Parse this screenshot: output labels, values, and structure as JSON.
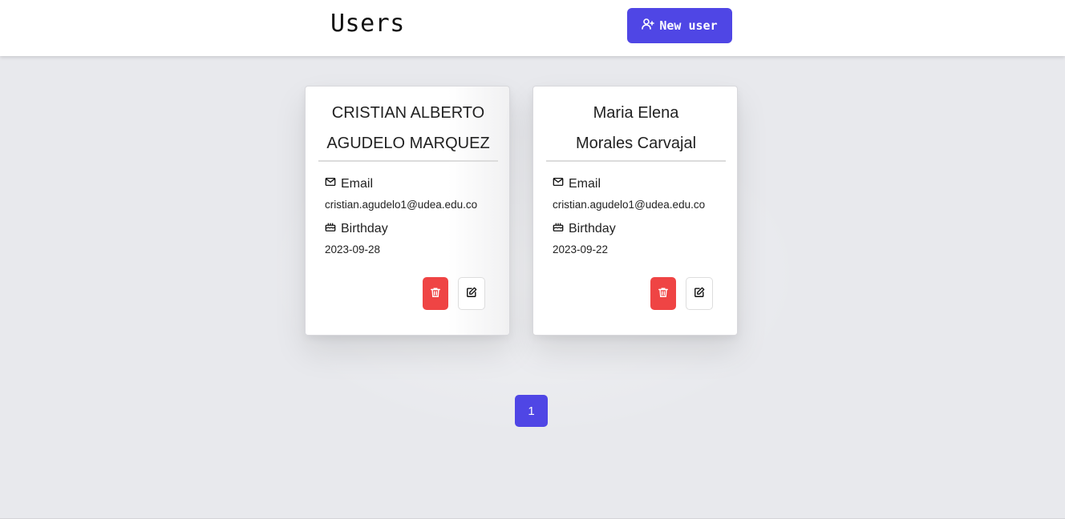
{
  "header": {
    "title": "Users",
    "new_user_label": "New user",
    "new_user_icon": "user-plus-icon"
  },
  "users": [
    {
      "name_line1": "CRISTIAN ALBERTO",
      "name_line2": "AGUDELO MARQUEZ",
      "email_label": "Email",
      "email": "cristian.agudelo1@udea.edu.co",
      "birthday_label": "Birthday",
      "birthday": "2023-09-28"
    },
    {
      "name_line1": "Maria Elena",
      "name_line2": "Morales Carvajal",
      "email_label": "Email",
      "email": "cristian.agudelo1@udea.edu.co",
      "birthday_label": "Birthday",
      "birthday": "2023-09-22"
    }
  ],
  "pagination": {
    "pages": [
      "1"
    ],
    "current": "1"
  },
  "colors": {
    "accent": "#4f46e5",
    "danger": "#ef4444",
    "background": "#e8e9ed"
  }
}
